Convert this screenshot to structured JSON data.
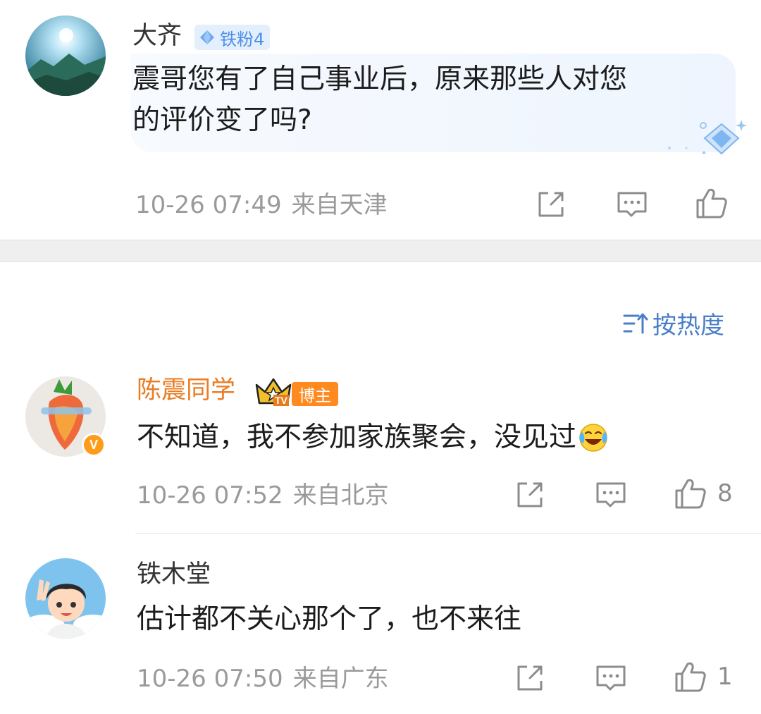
{
  "colors": {
    "blogger_name": "#ea7c24",
    "fan_badge": "#4d8ee6",
    "link_blue": "#4a7fc8",
    "meta_gray": "#9a9a9a"
  },
  "top_comment": {
    "username": "大齐",
    "fan_badge": "铁粉4",
    "text_line1": "震哥您有了自己事业后，原来那些人对您",
    "text_line2": "的评价变了吗?",
    "time": "10-26 07:49",
    "location": "来自天津"
  },
  "sort": {
    "label": "按热度",
    "icon": "sort-icon"
  },
  "replies": [
    {
      "username": "陈震同学",
      "crown_label": "TV",
      "badge": "博主",
      "verified": "V",
      "text": "不知道，我不参加家族聚会，没见过",
      "emoji": "laugh-cry-emoji",
      "time": "10-26 07:52",
      "location": "来自北京",
      "likes": "8"
    },
    {
      "username": "铁木堂",
      "text": "估计都不关心那个了，也不来往",
      "time": "10-26 07:50",
      "location": "来自广东",
      "likes": "1"
    }
  ],
  "icons": {
    "share": "share-icon",
    "comment": "comment-icon",
    "like": "like-icon"
  }
}
